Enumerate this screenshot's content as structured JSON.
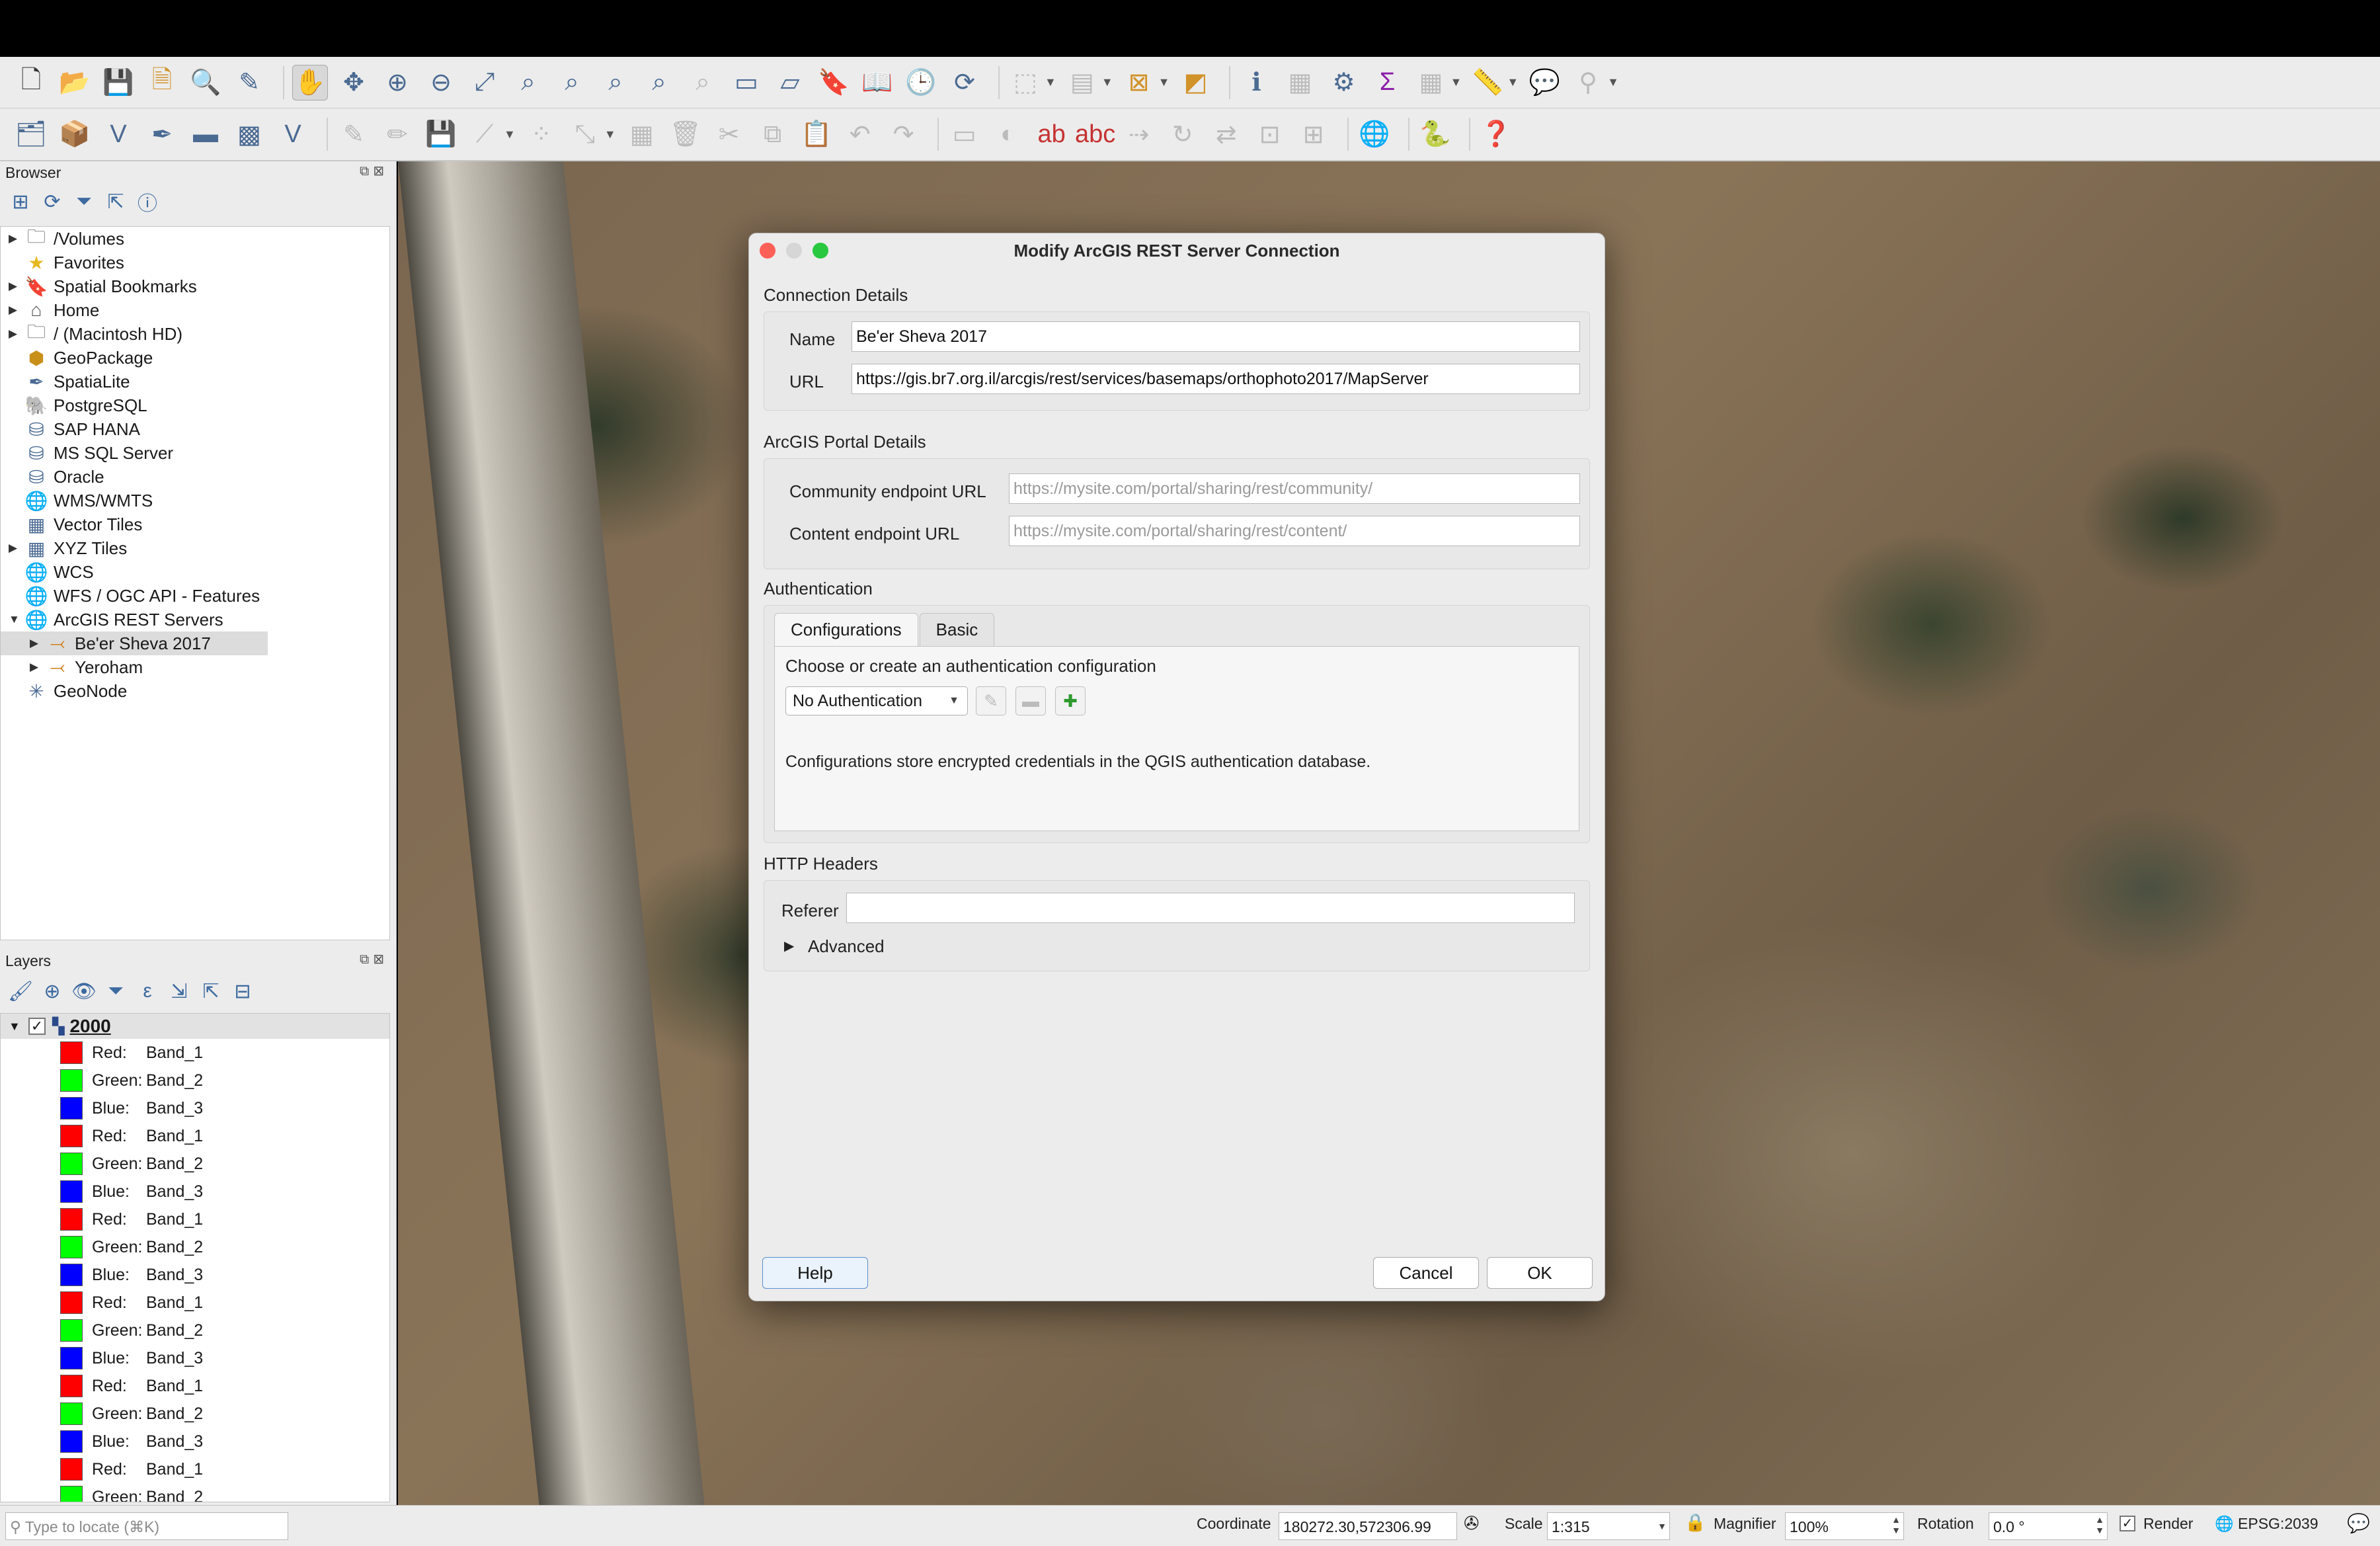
{
  "browser": {
    "title": "Browser",
    "items": [
      {
        "label": "/Volumes",
        "icon": "folder-icon",
        "arrow": true
      },
      {
        "label": "Favorites",
        "icon": "star-icon",
        "arrow": false
      },
      {
        "label": "Spatial Bookmarks",
        "icon": "bookmark-icon",
        "arrow": true
      },
      {
        "label": "Home",
        "icon": "home-icon",
        "arrow": true
      },
      {
        "label": "/ (Macintosh HD)",
        "icon": "folder-icon",
        "arrow": true
      },
      {
        "label": "GeoPackage",
        "icon": "geopackage-icon",
        "arrow": false
      },
      {
        "label": "SpatiaLite",
        "icon": "feather-icon",
        "arrow": false
      },
      {
        "label": "PostgreSQL",
        "icon": "elephant-icon",
        "arrow": false
      },
      {
        "label": "SAP HANA",
        "icon": "database-icon",
        "arrow": false
      },
      {
        "label": "MS SQL Server",
        "icon": "database-icon",
        "arrow": false
      },
      {
        "label": "Oracle",
        "icon": "database-icon",
        "arrow": false
      },
      {
        "label": "WMS/WMTS",
        "icon": "globe-icon",
        "arrow": false
      },
      {
        "label": "Vector Tiles",
        "icon": "grid-icon",
        "arrow": false
      },
      {
        "label": "XYZ Tiles",
        "icon": "grid-icon",
        "arrow": true
      },
      {
        "label": "WCS",
        "icon": "globe-icon",
        "arrow": false
      },
      {
        "label": "WFS / OGC API - Features",
        "icon": "globe-icon",
        "arrow": false
      },
      {
        "label": "ArcGIS REST Servers",
        "icon": "globe-icon",
        "arrow": true,
        "expanded": true
      },
      {
        "label": "Be'er Sheva 2017",
        "icon": "server-connection-icon",
        "arrow": true,
        "child": true,
        "selected": true
      },
      {
        "label": "Yeroham",
        "icon": "server-connection-icon",
        "arrow": true,
        "child": true
      },
      {
        "label": "GeoNode",
        "icon": "geonode-icon",
        "arrow": false
      }
    ]
  },
  "layers": {
    "title": "Layers",
    "root": {
      "name": "2000",
      "checked": true
    },
    "bands": [
      {
        "channel": "Red:",
        "band": "Band_1",
        "color": "#ff0000"
      },
      {
        "channel": "Green:",
        "band": "Band_2",
        "color": "#00ff00"
      },
      {
        "channel": "Blue:",
        "band": "Band_3",
        "color": "#0000ff"
      },
      {
        "channel": "Red:",
        "band": "Band_1",
        "color": "#ff0000"
      },
      {
        "channel": "Green:",
        "band": "Band_2",
        "color": "#00ff00"
      },
      {
        "channel": "Blue:",
        "band": "Band_3",
        "color": "#0000ff"
      },
      {
        "channel": "Red:",
        "band": "Band_1",
        "color": "#ff0000"
      },
      {
        "channel": "Green:",
        "band": "Band_2",
        "color": "#00ff00"
      },
      {
        "channel": "Blue:",
        "band": "Band_3",
        "color": "#0000ff"
      },
      {
        "channel": "Red:",
        "band": "Band_1",
        "color": "#ff0000"
      },
      {
        "channel": "Green:",
        "band": "Band_2",
        "color": "#00ff00"
      },
      {
        "channel": "Blue:",
        "band": "Band_3",
        "color": "#0000ff"
      },
      {
        "channel": "Red:",
        "band": "Band_1",
        "color": "#ff0000"
      },
      {
        "channel": "Green:",
        "band": "Band_2",
        "color": "#00ff00"
      },
      {
        "channel": "Blue:",
        "band": "Band_3",
        "color": "#0000ff"
      },
      {
        "channel": "Red:",
        "band": "Band_1",
        "color": "#ff0000"
      },
      {
        "channel": "Green:",
        "band": "Band_2",
        "color": "#00ff00"
      }
    ]
  },
  "dialog": {
    "title": "Modify ArcGIS REST Server Connection",
    "connection_details": {
      "label": "Connection Details",
      "name_label": "Name",
      "name_value": "Be'er Sheva 2017",
      "url_label": "URL",
      "url_value": "https://gis.br7.org.il/arcgis/rest/services/basemaps/orthophoto2017/MapServer"
    },
    "portal_details": {
      "label": "ArcGIS Portal Details",
      "community_label": "Community endpoint URL",
      "community_placeholder": "https://mysite.com/portal/sharing/rest/community/",
      "content_label": "Content endpoint URL",
      "content_placeholder": "https://mysite.com/portal/sharing/rest/content/"
    },
    "authentication": {
      "label": "Authentication",
      "tabs": [
        "Configurations",
        "Basic"
      ],
      "choose_text": "Choose or create an authentication configuration",
      "selected_config": "No Authentication",
      "info_text": "Configurations store encrypted credentials in the QGIS authentication database."
    },
    "http_headers": {
      "label": "HTTP Headers",
      "referer_label": "Referer",
      "referer_value": "",
      "advanced_label": "Advanced"
    },
    "buttons": {
      "help": "Help",
      "cancel": "Cancel",
      "ok": "OK"
    }
  },
  "statusbar": {
    "locate_placeholder": "Type to locate (⌘K)",
    "coordinate_label": "Coordinate",
    "coordinate_value": "180272.30,572306.99",
    "scale_label": "Scale",
    "scale_value": "1:315",
    "magnifier_label": "Magnifier",
    "magnifier_value": "100%",
    "rotation_label": "Rotation",
    "rotation_value": "0.0 °",
    "render_label": "Render",
    "render_checked": true,
    "crs": "EPSG:2039"
  },
  "colors": {
    "traffic_close": "#fe5f57",
    "traffic_min": "#d6d6d6",
    "traffic_max": "#28c840",
    "selection": "#dcdcdc"
  }
}
